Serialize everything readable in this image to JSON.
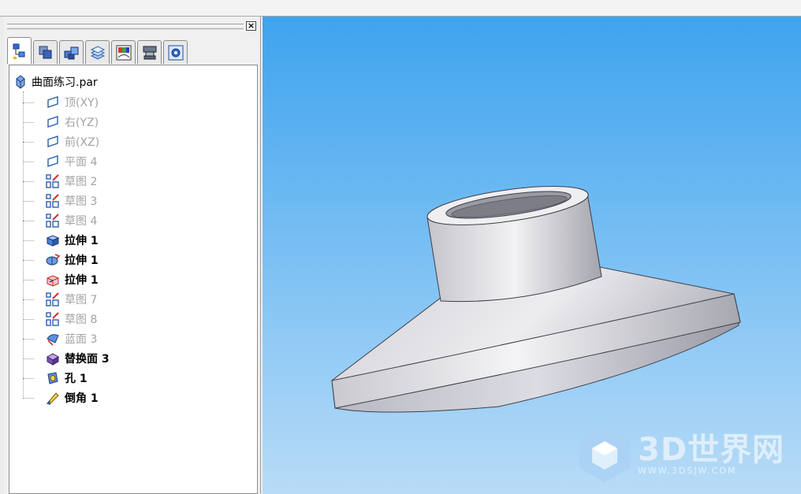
{
  "panel": {
    "close_glyph": "×",
    "tabs": [
      {
        "icon": "feature-tree-icon",
        "active": true
      },
      {
        "icon": "parts-library-icon"
      },
      {
        "icon": "family-of-parts-icon"
      },
      {
        "icon": "layers-icon"
      },
      {
        "icon": "color-manager-icon"
      },
      {
        "icon": "sensors-icon"
      },
      {
        "icon": "settings-icon"
      }
    ]
  },
  "tree": {
    "root": {
      "label": "曲面练习.par",
      "icon": "part-file-icon"
    },
    "items": [
      {
        "label": "顶(XY)",
        "icon": "reference-plane-icon",
        "state": "dim"
      },
      {
        "label": "右(YZ)",
        "icon": "reference-plane-icon",
        "state": "dim"
      },
      {
        "label": "前(XZ)",
        "icon": "reference-plane-icon",
        "state": "dim"
      },
      {
        "label": "平面 4",
        "icon": "reference-plane-icon",
        "state": "dim"
      },
      {
        "label": "草图 2",
        "icon": "sketch-icon",
        "state": "dim"
      },
      {
        "label": "草图 3",
        "icon": "sketch-icon",
        "state": "dim"
      },
      {
        "label": "草图 4",
        "icon": "sketch-icon",
        "state": "dim"
      },
      {
        "label": "拉伸 1",
        "icon": "extrude-icon",
        "state": "bold"
      },
      {
        "label": "拉伸 1",
        "icon": "revolve-icon",
        "state": "bold"
      },
      {
        "label": "拉伸 1",
        "icon": "extrude-surface-icon",
        "state": "bold"
      },
      {
        "label": "草图 7",
        "icon": "sketch-icon",
        "state": "dim"
      },
      {
        "label": "草图 8",
        "icon": "sketch-icon",
        "state": "dim"
      },
      {
        "label": "蓝面 3",
        "icon": "bluesurf-icon",
        "state": "dim"
      },
      {
        "label": "替换面 3",
        "icon": "replace-face-icon",
        "state": "bold"
      },
      {
        "label": "孔 1",
        "icon": "hole-icon",
        "state": "bold"
      },
      {
        "label": "倒角 1",
        "icon": "chamfer-icon",
        "state": "bold"
      }
    ]
  },
  "viewport": {
    "background_top": "#3ea3ee",
    "background_bottom": "#b8dcf7",
    "model": "revolved-part-with-hub"
  },
  "watermark": {
    "brand": "3D世界网",
    "url": "WWW.3DSJW.COM",
    "icon": "cube-logo-icon"
  }
}
